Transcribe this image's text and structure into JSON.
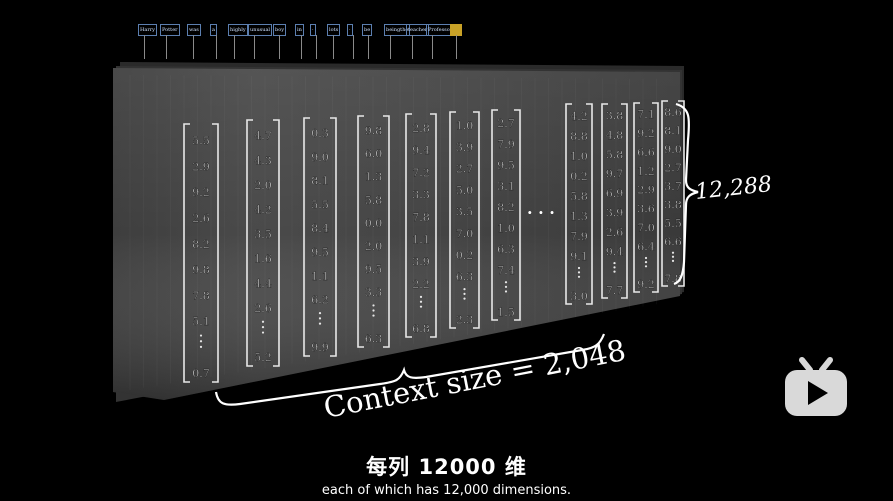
{
  "tokens": [
    "Harry",
    "Potter",
    "was",
    "a",
    "highly",
    "unusual",
    "boy",
    "in",
    "·",
    "lots",
    "·",
    "be",
    "beingthe",
    "teacher",
    "Professor",
    "·"
  ],
  "matrix": {
    "columns": [
      [
        "5.5",
        "2.9",
        "9.2",
        "2.6",
        "8.2",
        "9.8",
        "7.8",
        "5.1",
        "0.7"
      ],
      [
        "4.7",
        "4.3",
        "2.0",
        "4.2",
        "3.5",
        "1.6",
        "4.4",
        "2.6",
        "5.2"
      ],
      [
        "0.3",
        "9.0",
        "8.1",
        "5.5",
        "8.4",
        "9.5",
        "1.1",
        "6.2",
        "9.9"
      ],
      [
        "9.8",
        "6.0",
        "1.3",
        "5.8",
        "0.0",
        "2.0",
        "9.5",
        "3.3",
        "6.3"
      ],
      [
        "2.8",
        "9.4",
        "7.2",
        "3.3",
        "7.8",
        "1.1",
        "3.9",
        "2.2",
        "6.8"
      ],
      [
        "1.0",
        "3.9",
        "2.7",
        "5.0",
        "3.5",
        "7.0",
        "0.2",
        "6.3",
        "2.3"
      ],
      [
        "2.7",
        "7.9",
        "9.5",
        "3.1",
        "8.2",
        "1.0",
        "6.3",
        "7.4",
        "1.5"
      ],
      [
        "4.2",
        "8.8",
        "1.0",
        "0.2",
        "5.8",
        "1.3",
        "7.9",
        "9.1",
        "3.0"
      ],
      [
        "3.8",
        "4.8",
        "5.8",
        "9.7",
        "6.9",
        "3.9",
        "2.6",
        "9.4",
        "7.7"
      ],
      [
        "7.1",
        "9.2",
        "6.6",
        "1.2",
        "2.9",
        "3.6",
        "7.0",
        "6.4",
        "9.2"
      ],
      [
        "8.6",
        "8.1",
        "9.0",
        "2.7",
        "3.7",
        "3.8",
        "5.5",
        "6.6",
        "7.8"
      ]
    ],
    "ellipsis": "· · ·",
    "context_label": "Context size = 2,048",
    "dimension_label": "12,288"
  },
  "subtitles": {
    "chinese": "每列 12000 维",
    "english": "each of which has 12,000 dimensions."
  },
  "logo": {
    "name": "bilibili-tv-icon",
    "color": "#d9d9d9"
  }
}
